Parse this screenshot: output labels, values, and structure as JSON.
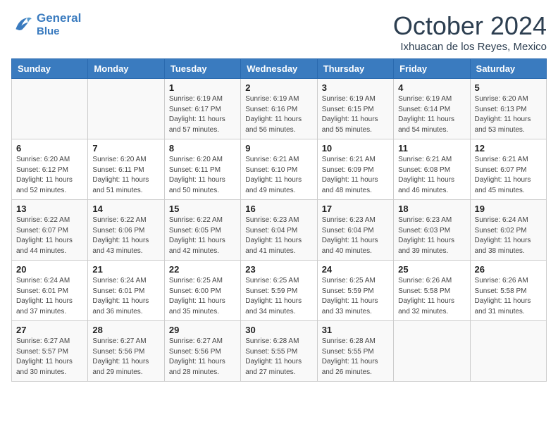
{
  "header": {
    "logo_line1": "General",
    "logo_line2": "Blue",
    "month": "October 2024",
    "location": "Ixhuacan de los Reyes, Mexico"
  },
  "days_of_week": [
    "Sunday",
    "Monday",
    "Tuesday",
    "Wednesday",
    "Thursday",
    "Friday",
    "Saturday"
  ],
  "weeks": [
    [
      {
        "day": "",
        "info": ""
      },
      {
        "day": "",
        "info": ""
      },
      {
        "day": "1",
        "info": "Sunrise: 6:19 AM\nSunset: 6:17 PM\nDaylight: 11 hours and 57 minutes."
      },
      {
        "day": "2",
        "info": "Sunrise: 6:19 AM\nSunset: 6:16 PM\nDaylight: 11 hours and 56 minutes."
      },
      {
        "day": "3",
        "info": "Sunrise: 6:19 AM\nSunset: 6:15 PM\nDaylight: 11 hours and 55 minutes."
      },
      {
        "day": "4",
        "info": "Sunrise: 6:19 AM\nSunset: 6:14 PM\nDaylight: 11 hours and 54 minutes."
      },
      {
        "day": "5",
        "info": "Sunrise: 6:20 AM\nSunset: 6:13 PM\nDaylight: 11 hours and 53 minutes."
      }
    ],
    [
      {
        "day": "6",
        "info": "Sunrise: 6:20 AM\nSunset: 6:12 PM\nDaylight: 11 hours and 52 minutes."
      },
      {
        "day": "7",
        "info": "Sunrise: 6:20 AM\nSunset: 6:11 PM\nDaylight: 11 hours and 51 minutes."
      },
      {
        "day": "8",
        "info": "Sunrise: 6:20 AM\nSunset: 6:11 PM\nDaylight: 11 hours and 50 minutes."
      },
      {
        "day": "9",
        "info": "Sunrise: 6:21 AM\nSunset: 6:10 PM\nDaylight: 11 hours and 49 minutes."
      },
      {
        "day": "10",
        "info": "Sunrise: 6:21 AM\nSunset: 6:09 PM\nDaylight: 11 hours and 48 minutes."
      },
      {
        "day": "11",
        "info": "Sunrise: 6:21 AM\nSunset: 6:08 PM\nDaylight: 11 hours and 46 minutes."
      },
      {
        "day": "12",
        "info": "Sunrise: 6:21 AM\nSunset: 6:07 PM\nDaylight: 11 hours and 45 minutes."
      }
    ],
    [
      {
        "day": "13",
        "info": "Sunrise: 6:22 AM\nSunset: 6:07 PM\nDaylight: 11 hours and 44 minutes."
      },
      {
        "day": "14",
        "info": "Sunrise: 6:22 AM\nSunset: 6:06 PM\nDaylight: 11 hours and 43 minutes."
      },
      {
        "day": "15",
        "info": "Sunrise: 6:22 AM\nSunset: 6:05 PM\nDaylight: 11 hours and 42 minutes."
      },
      {
        "day": "16",
        "info": "Sunrise: 6:23 AM\nSunset: 6:04 PM\nDaylight: 11 hours and 41 minutes."
      },
      {
        "day": "17",
        "info": "Sunrise: 6:23 AM\nSunset: 6:04 PM\nDaylight: 11 hours and 40 minutes."
      },
      {
        "day": "18",
        "info": "Sunrise: 6:23 AM\nSunset: 6:03 PM\nDaylight: 11 hours and 39 minutes."
      },
      {
        "day": "19",
        "info": "Sunrise: 6:24 AM\nSunset: 6:02 PM\nDaylight: 11 hours and 38 minutes."
      }
    ],
    [
      {
        "day": "20",
        "info": "Sunrise: 6:24 AM\nSunset: 6:01 PM\nDaylight: 11 hours and 37 minutes."
      },
      {
        "day": "21",
        "info": "Sunrise: 6:24 AM\nSunset: 6:01 PM\nDaylight: 11 hours and 36 minutes."
      },
      {
        "day": "22",
        "info": "Sunrise: 6:25 AM\nSunset: 6:00 PM\nDaylight: 11 hours and 35 minutes."
      },
      {
        "day": "23",
        "info": "Sunrise: 6:25 AM\nSunset: 5:59 PM\nDaylight: 11 hours and 34 minutes."
      },
      {
        "day": "24",
        "info": "Sunrise: 6:25 AM\nSunset: 5:59 PM\nDaylight: 11 hours and 33 minutes."
      },
      {
        "day": "25",
        "info": "Sunrise: 6:26 AM\nSunset: 5:58 PM\nDaylight: 11 hours and 32 minutes."
      },
      {
        "day": "26",
        "info": "Sunrise: 6:26 AM\nSunset: 5:58 PM\nDaylight: 11 hours and 31 minutes."
      }
    ],
    [
      {
        "day": "27",
        "info": "Sunrise: 6:27 AM\nSunset: 5:57 PM\nDaylight: 11 hours and 30 minutes."
      },
      {
        "day": "28",
        "info": "Sunrise: 6:27 AM\nSunset: 5:56 PM\nDaylight: 11 hours and 29 minutes."
      },
      {
        "day": "29",
        "info": "Sunrise: 6:27 AM\nSunset: 5:56 PM\nDaylight: 11 hours and 28 minutes."
      },
      {
        "day": "30",
        "info": "Sunrise: 6:28 AM\nSunset: 5:55 PM\nDaylight: 11 hours and 27 minutes."
      },
      {
        "day": "31",
        "info": "Sunrise: 6:28 AM\nSunset: 5:55 PM\nDaylight: 11 hours and 26 minutes."
      },
      {
        "day": "",
        "info": ""
      },
      {
        "day": "",
        "info": ""
      }
    ]
  ]
}
